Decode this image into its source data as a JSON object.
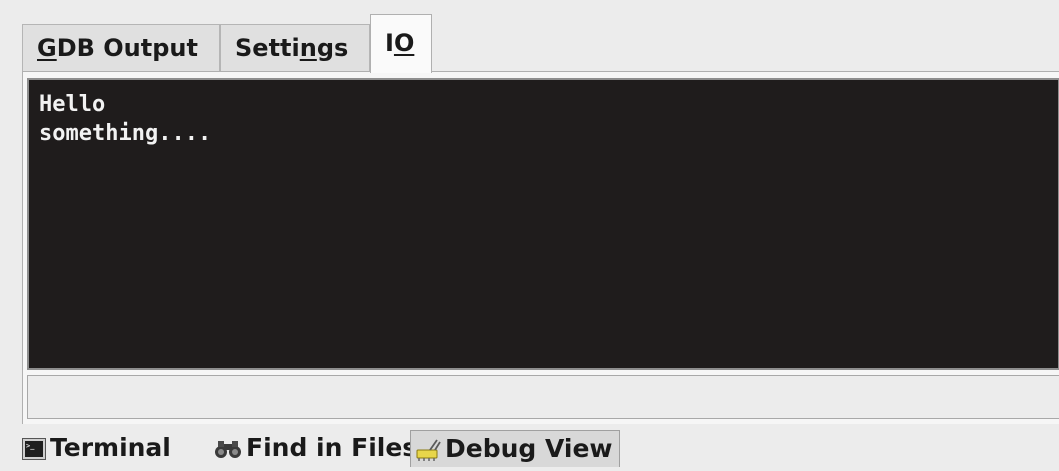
{
  "tabs": [
    {
      "label_prefix": "",
      "mnemonic": "G",
      "label_suffix": "DB Output"
    },
    {
      "label_prefix": "Setti",
      "mnemonic": "n",
      "label_suffix": "gs"
    },
    {
      "label_prefix": "I",
      "mnemonic": "O",
      "label_suffix": ""
    }
  ],
  "console": {
    "lines": [
      "Hello",
      "something...."
    ]
  },
  "input": {
    "value": ""
  },
  "bottom_tabs": [
    {
      "label": "Terminal",
      "icon": "terminal-icon"
    },
    {
      "label": "Find in Files",
      "icon": "binoculars-icon"
    },
    {
      "label": "Debug View",
      "icon": "debug-icon"
    }
  ]
}
